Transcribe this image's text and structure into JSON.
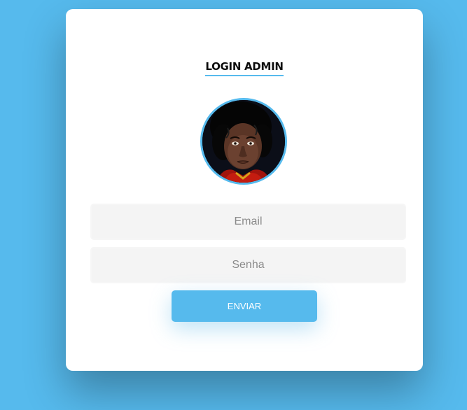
{
  "login": {
    "title": "LOGIN ADMIN",
    "email_placeholder": "Email",
    "password_placeholder": "Senha",
    "submit_label": "ENVIAR"
  },
  "colors": {
    "background": "#56baed",
    "accent": "#56baed",
    "card": "#ffffff",
    "field_bg": "#f4f4f4"
  }
}
